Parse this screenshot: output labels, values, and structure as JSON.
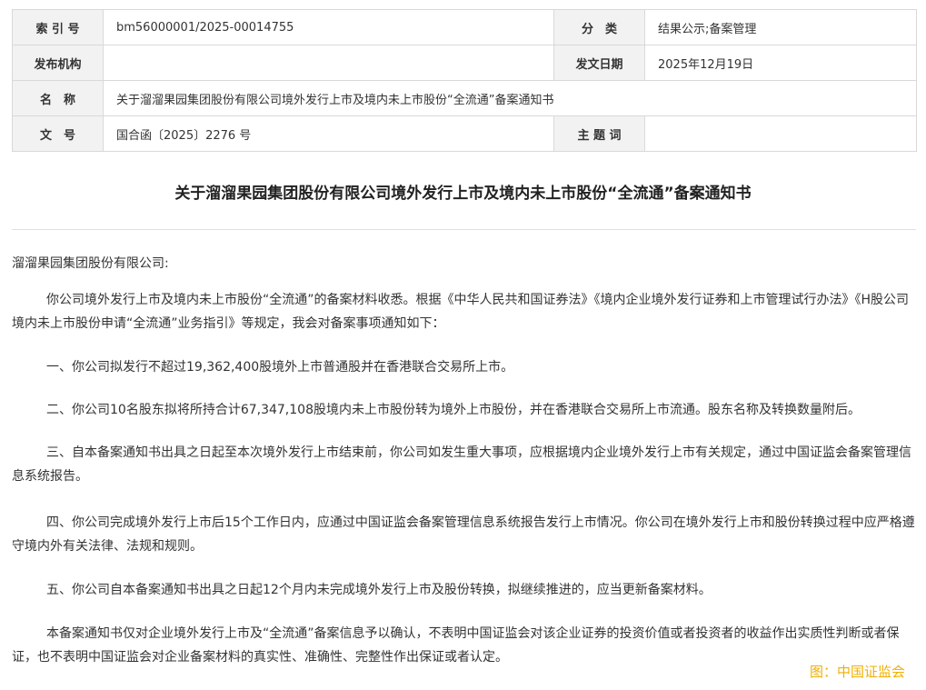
{
  "meta": {
    "index_label": "索 引 号",
    "index_value": "bm56000001/2025-00014755",
    "category_label": "分　类",
    "category_value": "结果公示;备案管理",
    "publisher_label": "发布机构",
    "publisher_value": "",
    "date_label": "发文日期",
    "date_value": "2025年12月19日",
    "name_label": "名　称",
    "name_value": "关于溜溜果园集团股份有限公司境外发行上市及境内未上市股份“全流通”备案通知书",
    "docno_label": "文　号",
    "docno_value": "国合函〔2025〕2276 号",
    "keyword_label": "主 题 词",
    "keyword_value": ""
  },
  "title": "关于溜溜果园集团股份有限公司境外发行上市及境内未上市股份“全流通”备案通知书",
  "salutation": "溜溜果园集团股份有限公司:",
  "paragraphs": [
    "你公司境外发行上市及境内未上市股份“全流通”的备案材料收悉。根据《中华人民共和国证券法》《境内企业境外发行证券和上市管理试行办法》《H股公司境内未上市股份申请“全流通”业务指引》等规定，我会对备案事项通知如下：",
    "一、你公司拟发行不超过19,362,400股境外上市普通股并在香港联合交易所上市。",
    "二、你公司10名股东拟将所持合计67,347,108股境内未上市股份转为境外上市股份，并在香港联合交易所上市流通。股东名称及转换数量附后。",
    "三、自本备案通知书出具之日起至本次境外发行上市结束前，你公司如发生重大事项，应根据境内企业境外发行上市有关规定，通过中国证监会备案管理信息系统报告。",
    "四、你公司完成境外发行上市后15个工作日内，应通过中国证监会备案管理信息系统报告发行上市情况。你公司在境外发行上市和股份转换过程中应严格遵守境内外有关法律、法规和规则。",
    "五、你公司自本备案通知书出具之日起12个月内未完成境外发行上市及股份转换，拟继续推进的，应当更新备案材料。",
    "本备案通知书仅对企业境外发行上市及“全流通”备案信息予以确认，不表明中国证监会对该企业证券的投资价值或者投资者的收益作出实质性判断或者保证，也不表明中国证监会对企业备案材料的真实性、准确性、完整性作出保证或者认定。"
  ],
  "watermark": "图：中国证监会"
}
